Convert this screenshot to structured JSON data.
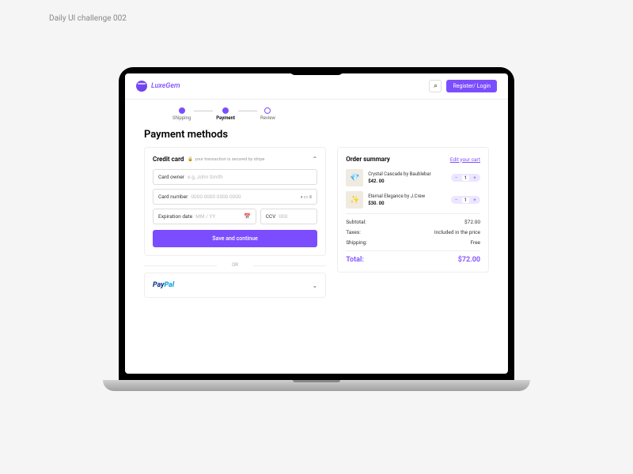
{
  "page_label": "Daily UI challenge 002",
  "brand": "LuxeGem",
  "header": {
    "login": "Register/ Login"
  },
  "steps": [
    {
      "label": "Shipping"
    },
    {
      "label": "Payment"
    },
    {
      "label": "Review"
    }
  ],
  "title": "Payment methods",
  "cc": {
    "title": "Credit card",
    "secure": "your transaction is secured by stripe",
    "owner_label": "Card owner",
    "owner_placeholder": "e.g, John Smith",
    "number_label": "Card number",
    "number_placeholder": "0000 0000 0000 0000",
    "exp_label": "Expiration date",
    "exp_placeholder": "MM / YY",
    "ccv_label": "CCV",
    "ccv_placeholder": "000",
    "save": "Save and continue"
  },
  "divider": "OR",
  "paypal": "PayPal",
  "summary": {
    "title": "Order summary",
    "edit": "Edit your cart",
    "items": [
      {
        "name": "Crystal Cascade by Baublebar",
        "price": "$42. 00",
        "qty": "1"
      },
      {
        "name": "Eternal Elegance by J.Crew",
        "price": "$30. 00",
        "qty": "1"
      }
    ],
    "subtotal_label": "Subtotal:",
    "subtotal": "$72.00",
    "taxes_label": "Taxes:",
    "taxes": "Included in the price",
    "shipping_label": "Shipping:",
    "shipping": "Free",
    "total_label": "Total:",
    "total": "$72.00"
  }
}
